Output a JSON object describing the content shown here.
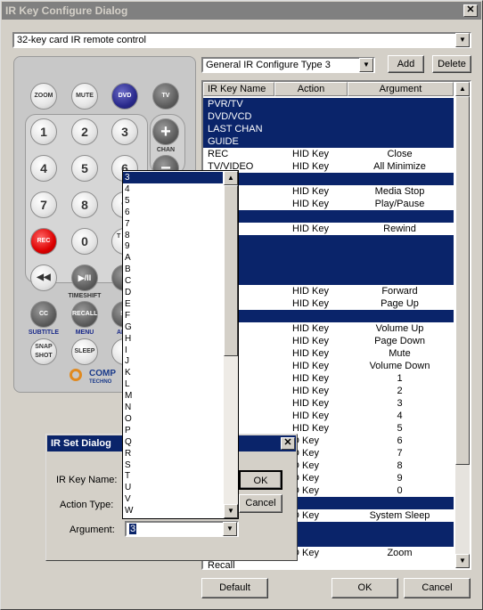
{
  "window": {
    "title": "IR Key Configure Dialog",
    "close_label": "✕"
  },
  "remote_selector": {
    "value": "32-key card IR remote control"
  },
  "config_type": {
    "value": "General IR Configure Type 3"
  },
  "buttons": {
    "add": "Add",
    "delete": "Delete",
    "default": "Default",
    "ok": "OK",
    "cancel": "Cancel"
  },
  "table": {
    "headers": [
      "IR Key Name",
      "Action",
      "Argument"
    ],
    "rows": [
      {
        "name": "PVR/TV",
        "action": "",
        "arg": "",
        "selected": true
      },
      {
        "name": "DVD/VCD",
        "action": "",
        "arg": "",
        "selected": true
      },
      {
        "name": "LAST CHAN",
        "action": "",
        "arg": "",
        "selected": true
      },
      {
        "name": "GUIDE",
        "action": "",
        "arg": "",
        "selected": true
      },
      {
        "name": "REC",
        "action": "HID Key",
        "arg": "Close",
        "selected": false
      },
      {
        "name": "TV/VIDEO",
        "action": "HID Key",
        "arg": "All Minimize",
        "selected": false
      },
      {
        "name": "",
        "action": "",
        "arg": "",
        "selected": true
      },
      {
        "name": "",
        "action": "HID Key",
        "arg": "Media Stop",
        "selected": false
      },
      {
        "name": "IFT",
        "action": "HID Key",
        "arg": "Play/Pause",
        "selected": false
      },
      {
        "name": "",
        "action": "",
        "arg": "",
        "selected": true
      },
      {
        "name": "D",
        "action": "HID Key",
        "arg": "Rewind",
        "selected": false
      },
      {
        "name": "",
        "action": "",
        "arg": "",
        "selected": true
      },
      {
        "name": "",
        "action": "",
        "arg": "",
        "selected": true
      },
      {
        "name": "",
        "action": "",
        "arg": "",
        "selected": true
      },
      {
        "name": "",
        "action": "",
        "arg": "",
        "selected": true
      },
      {
        "name": "ARD",
        "action": "HID Key",
        "arg": "Forward",
        "selected": false
      },
      {
        "name": "",
        "action": "HID Key",
        "arg": "Page Up",
        "selected": false
      },
      {
        "name": "",
        "action": "",
        "arg": "",
        "selected": true
      },
      {
        "name": "",
        "action": "HID Key",
        "arg": "Volume Up",
        "selected": false
      },
      {
        "name": "",
        "action": "HID Key",
        "arg": "Page Down",
        "selected": false
      },
      {
        "name": "",
        "action": "HID Key",
        "arg": "Mute",
        "selected": false
      },
      {
        "name": "",
        "action": "HID Key",
        "arg": "Volume Down",
        "selected": false
      },
      {
        "name": "",
        "action": "HID Key",
        "arg": "1",
        "selected": false
      },
      {
        "name": "",
        "action": "HID Key",
        "arg": "2",
        "selected": false
      },
      {
        "name": "",
        "action": "HID Key",
        "arg": "3",
        "selected": false
      },
      {
        "name": "",
        "action": "HID Key",
        "arg": "4",
        "selected": false
      },
      {
        "name": "",
        "action": "HID Key",
        "arg": "5",
        "selected": false
      },
      {
        "name": "",
        "action": "D Key",
        "arg": "6",
        "selected": false
      },
      {
        "name": "",
        "action": "D Key",
        "arg": "7",
        "selected": false
      },
      {
        "name": "",
        "action": "D Key",
        "arg": "8",
        "selected": false
      },
      {
        "name": "",
        "action": "D Key",
        "arg": "9",
        "selected": false
      },
      {
        "name": "",
        "action": "D Key",
        "arg": "0",
        "selected": false
      },
      {
        "name": "",
        "action": "",
        "arg": "",
        "selected": true
      },
      {
        "name": "",
        "action": "D Key",
        "arg": "System Sleep",
        "selected": false
      },
      {
        "name": "",
        "action": "",
        "arg": "",
        "selected": true
      },
      {
        "name": "",
        "action": "",
        "arg": "",
        "selected": true
      },
      {
        "name": "",
        "action": "D Key",
        "arg": "Zoom",
        "selected": false
      },
      {
        "name": "Recall",
        "action": "",
        "arg": "",
        "selected": false
      }
    ]
  },
  "remote": {
    "top_buttons": [
      "ZOOM",
      "MUTE",
      "DVD",
      "TV"
    ],
    "digits": [
      "1",
      "2",
      "3",
      "4",
      "5",
      "6",
      "7",
      "8",
      "9",
      "0"
    ],
    "rec": "REC",
    "tv_partial": "T VID",
    "chan_label": "CHAN",
    "plus": "+",
    "minus": "−",
    "rewind": "◀◀",
    "play": "▶/II",
    "timeshift_label": "TIMESHIFT",
    "last_partial": "L",
    "cc": "CC",
    "recall": "RECALL",
    "su_partial": "SU",
    "subtitle_label": "SUBTITLE",
    "menu_label": "MENU",
    "an_partial": "AN",
    "snapshot": "SNAP SHOT",
    "sleep": "SLEEP",
    "brand_partial": "COMP",
    "brand_sub_partial": "TECHNO"
  },
  "ir_dialog": {
    "title": "IR Set Dialog",
    "close_label": "✕",
    "key_name_label": "IR Key Name:",
    "action_type_label": "Action Type:",
    "argument_label": "Argument:",
    "argument_value": "3",
    "ok": "OK",
    "cancel": "Cancel"
  },
  "popup_list": {
    "items": [
      "3",
      "4",
      "5",
      "6",
      "7",
      "8",
      "9",
      "A",
      "B",
      "C",
      "D",
      "E",
      "F",
      "G",
      "H",
      "I",
      "J",
      "K",
      "L",
      "M",
      "N",
      "O",
      "P",
      "Q",
      "R",
      "S",
      "T",
      "U",
      "V",
      "W"
    ],
    "selected_index": 0
  }
}
